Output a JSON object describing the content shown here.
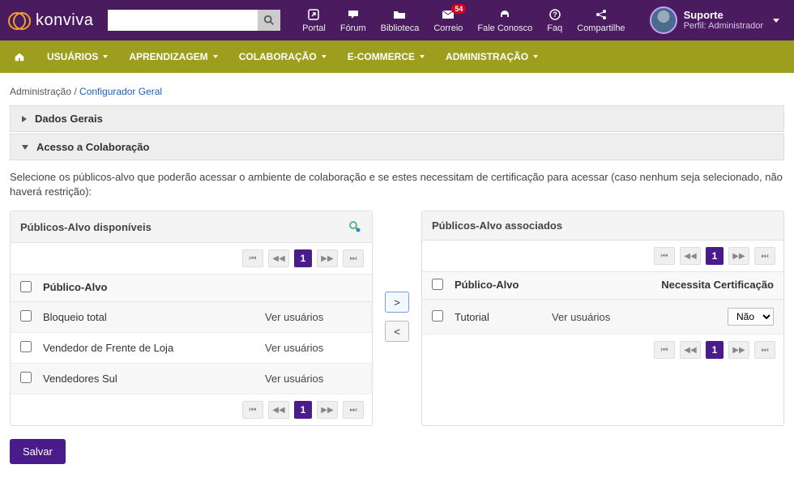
{
  "brand": "konviva",
  "search": {
    "placeholder": ""
  },
  "topnav": [
    {
      "label": "Portal",
      "icon": "external-icon"
    },
    {
      "label": "Fórum",
      "icon": "chat-icon"
    },
    {
      "label": "Biblioteca",
      "icon": "folder-icon"
    },
    {
      "label": "Correio",
      "icon": "mail-icon",
      "badge": "54"
    },
    {
      "label": "Fale Conosco",
      "icon": "headset-icon"
    },
    {
      "label": "Faq",
      "icon": "question-icon"
    },
    {
      "label": "Compartilhe",
      "icon": "share-icon"
    }
  ],
  "user": {
    "name": "Suporte",
    "role": "Perfil: Administrador"
  },
  "mainnav": [
    "USUÁRIOS",
    "APRENDIZAGEM",
    "COLABORAÇÃO",
    "E-COMMERCE",
    "ADMINISTRAÇÃO"
  ],
  "breadcrumb": {
    "parent": "Administração",
    "sep": " / ",
    "current": "Configurador Geral"
  },
  "panels": {
    "dados_gerais": "Dados Gerais",
    "acesso": "Acesso a Colaboração"
  },
  "instructions": "Selecione os públicos-alvo que poderão acessar o ambiente de colaboração e se estes necessitam de certificação para acessar (caso nenhum seja selecionado, não haverá restrição):",
  "available": {
    "title": "Públicos-Alvo disponíveis",
    "col_name": "Público-Alvo",
    "view_label": "Ver usuários",
    "page": "1",
    "rows": [
      {
        "name": "Bloqueio total"
      },
      {
        "name": "Vendedor de Frente de Loja"
      },
      {
        "name": "Vendedores Sul"
      }
    ]
  },
  "associated": {
    "title": "Públicos-Alvo associados",
    "col_name": "Público-Alvo",
    "col_cert": "Necessita Certificação",
    "view_label": "Ver usuários",
    "page": "1",
    "rows": [
      {
        "name": "Tutorial",
        "cert": "Não"
      }
    ]
  },
  "buttons": {
    "move_right": ">",
    "move_left": "<",
    "save": "Salvar"
  }
}
